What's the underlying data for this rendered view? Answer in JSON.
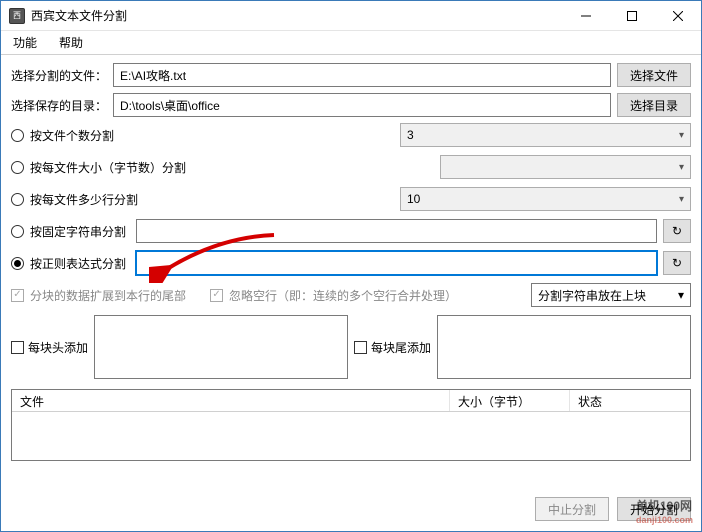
{
  "window": {
    "title": "西宾文本文件分割",
    "icon_label": "西"
  },
  "menu": {
    "func": "功能",
    "help": "帮助"
  },
  "file_row": {
    "label": "选择分割的文件：",
    "value": "E:\\AI攻略.txt",
    "button": "选择文件"
  },
  "dir_row": {
    "label": "选择保存的目录：",
    "value": "D:\\tools\\桌面\\office",
    "button": "选择目录"
  },
  "radios": {
    "by_count": {
      "label": "按文件个数分割",
      "value": "3"
    },
    "by_size": {
      "label": "按每文件大小（字节数）分割",
      "value": ""
    },
    "by_lines": {
      "label": "按每文件多少行分割",
      "value": "10"
    },
    "by_fixed": {
      "label": "按固定字符串分割"
    },
    "by_regex": {
      "label": "按正则表达式分割"
    }
  },
  "options": {
    "extend": "分块的数据扩展到本行的尾部",
    "skip_blank": "忽略空行（即：连续的多个空行合并处理）",
    "split_pos": "分割字符串放在上块"
  },
  "append": {
    "head": "每块头添加",
    "tail": "每块尾添加"
  },
  "table": {
    "col1": "文件",
    "col2": "大小（字节）",
    "col3": "状态"
  },
  "footer": {
    "stop": "中止分割",
    "start": "开始分割"
  },
  "icons": {
    "refresh": "↻"
  },
  "watermark": {
    "main": "单机100网",
    "sub": "danji100.com"
  }
}
